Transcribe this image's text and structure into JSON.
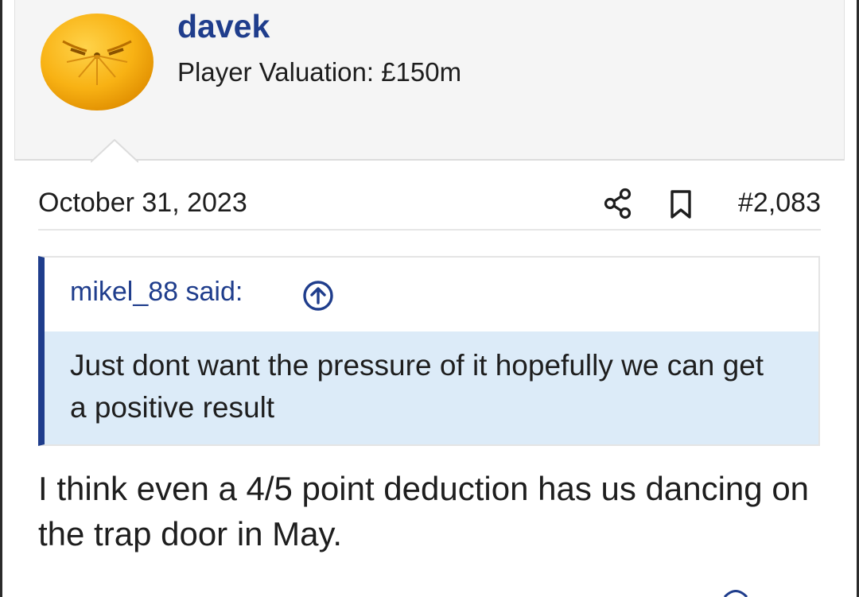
{
  "user": {
    "name": "davek",
    "title": "Player Valuation: £150m",
    "avatar_icon": "orange-face-avatar"
  },
  "post": {
    "date": "October 31, 2023",
    "number": "#2,083",
    "share_icon": "share-icon",
    "bookmark_icon": "bookmark-icon",
    "body": "I think even a 4/5 point deduction has us dancing on the trap door in May."
  },
  "quote": {
    "author": "mikel_88 said:",
    "jump_icon": "arrow-up-circle-icon",
    "text": "Just dont want the pressure of it hopefully we can get a positive result"
  },
  "colors": {
    "accent": "#1f3d8c",
    "quote_bg": "#dcebf8",
    "header_bg": "#f5f5f5"
  }
}
